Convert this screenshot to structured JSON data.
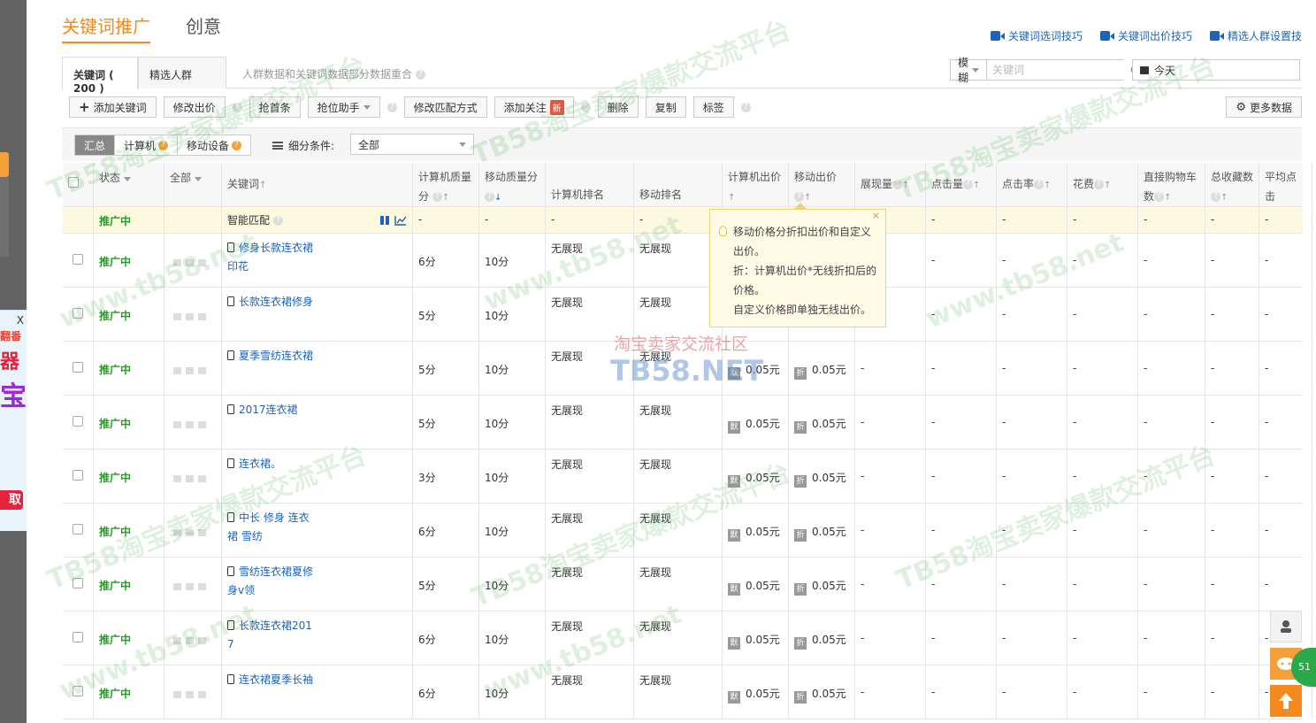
{
  "top_tabs": [
    {
      "label": "关键词推广",
      "active": true
    },
    {
      "label": "创意",
      "active": false
    }
  ],
  "help_links": [
    "关键词选词技巧",
    "关键词出价技巧",
    "精选人群设置技"
  ],
  "sub_tabs": [
    {
      "label": "关键词 ( 200 )",
      "active": true
    },
    {
      "label": "精选人群",
      "active": false
    }
  ],
  "sub_note": "人群数据和关键词数据部分数据重合",
  "search": {
    "mode": "模糊",
    "placeholder": "关键词",
    "value": ""
  },
  "date_range": "今天",
  "toolbar": {
    "add_keyword": "添加关键词",
    "edit_bid": "修改出价",
    "grab_top": "抢首条",
    "rank_helper": "抢位助手",
    "edit_match": "修改匹配方式",
    "add_follow": "添加关注",
    "new_badge": "新",
    "delete": "删除",
    "copy": "复制",
    "tag": "标签",
    "more_data": "更多数据"
  },
  "filter": {
    "segments": [
      "汇总",
      "计算机",
      "移动设备"
    ],
    "active_segment": "汇总",
    "label": "细分条件:",
    "select_value": "全部"
  },
  "columns": {
    "status": "状态",
    "all": "全部",
    "keyword": "关键词",
    "pc_quality_1": "计算机质量",
    "pc_quality_2": "分",
    "mobile_quality": "移动质量分",
    "pc_rank": "计算机排名",
    "mobile_rank": "移动排名",
    "pc_bid": "计算机出价",
    "mobile_bid": "移动出价",
    "impressions": "展现量",
    "clicks": "点击量",
    "ctr": "点击率",
    "cost": "花费",
    "direct_cart_1": "直接购物车",
    "direct_cart_2": "数",
    "total_fav": "总收藏数",
    "avg_click_1": "平均点击",
    "avg_click_2": "费"
  },
  "smart_row": {
    "status": "推广中",
    "keyword": "智能匹配",
    "dash": "-"
  },
  "rows": [
    {
      "status": "推广中",
      "kw1": "修身长款连衣裙",
      "kw2": "印花",
      "pcq": "6分",
      "mq": "10分",
      "pcr": "无展现",
      "mr": "无展现",
      "pcb": "",
      "mb": ""
    },
    {
      "status": "推广中",
      "kw1": "长款连衣裙修身",
      "kw2": "",
      "pcq": "5分",
      "mq": "10分",
      "pcr": "无展现",
      "mr": "无展现",
      "pcb": "",
      "mb": ""
    },
    {
      "status": "推广中",
      "kw1": "夏季雪纺连衣裙",
      "kw2": "",
      "pcq": "5分",
      "mq": "10分",
      "pcr": "无展现",
      "mr": "无展现",
      "pcb": "0.05元",
      "mb": "0.05元"
    },
    {
      "status": "推广中",
      "kw1": "2017连衣裙",
      "kw2": "",
      "pcq": "5分",
      "mq": "10分",
      "pcr": "无展现",
      "mr": "无展现",
      "pcb": "0.05元",
      "mb": "0.05元"
    },
    {
      "status": "推广中",
      "kw1": "连衣裙。",
      "kw2": "",
      "pcq": "3分",
      "mq": "10分",
      "pcr": "无展现",
      "mr": "无展现",
      "pcb": "0.05元",
      "mb": "0.05元"
    },
    {
      "status": "推广中",
      "kw1": "中长 修身 连衣",
      "kw2": "裙 雪纺",
      "pcq": "6分",
      "mq": "10分",
      "pcr": "无展现",
      "mr": "无展现",
      "pcb": "0.05元",
      "mb": "0.05元"
    },
    {
      "status": "推广中",
      "kw1": "雪纺连衣裙夏修",
      "kw2": "身v领",
      "pcq": "5分",
      "mq": "10分",
      "pcr": "无展现",
      "mr": "无展现",
      "pcb": "0.05元",
      "mb": "0.05元"
    },
    {
      "status": "推广中",
      "kw1": "长款连衣裙201",
      "kw2": "7",
      "pcq": "6分",
      "mq": "10分",
      "pcr": "无展现",
      "mr": "无展现",
      "pcb": "0.05元",
      "mb": "0.05元"
    },
    {
      "status": "推广中",
      "kw1": "连衣裙夏季长袖",
      "kw2": "",
      "pcq": "6分",
      "mq": "10分",
      "pcr": "无展现",
      "mr": "无展现",
      "pcb": "0.05元",
      "mb": "0.05元"
    }
  ],
  "dash": "-",
  "price_tag_pc": "默",
  "price_tag_mobile": "折",
  "tooltip": {
    "line1": "移动价格分折扣出价和自定义",
    "line2": "出价。",
    "line3": "折：计算机出价*无线折扣后的",
    "line4": "价格。",
    "line5": "自定义价格即单独无线出价。",
    "close": "×"
  },
  "ad": {
    "close": "X",
    "t1": "翻番",
    "t2": "器",
    "t3": "宝",
    "btn": "取"
  },
  "side_badge": "51",
  "watermark": {
    "main": "TB58淘宝卖家爆款交流平台",
    "url": "www.tb58.net",
    "center1": "淘宝卖家交流社区",
    "center2": "TB58.NET"
  },
  "colors": {
    "accent": "#f28a20",
    "link": "#1e63b4",
    "status": "#2a9a2a"
  }
}
